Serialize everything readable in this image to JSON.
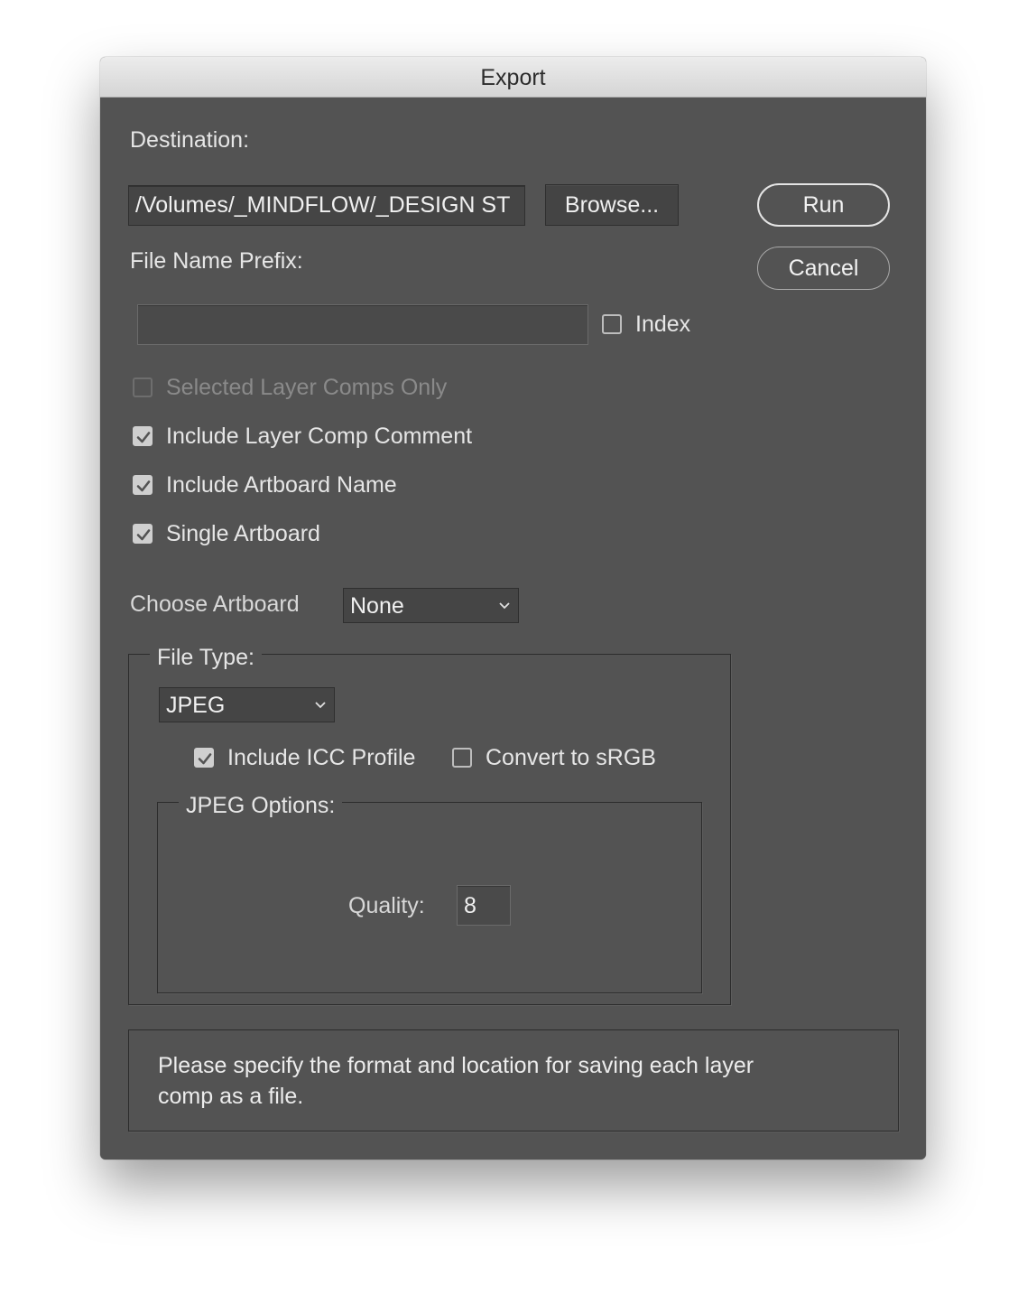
{
  "window": {
    "title": "Export"
  },
  "destination": {
    "label": "Destination:",
    "value": "/Volumes/_MINDFLOW/_DESIGN ST",
    "browse_label": "Browse..."
  },
  "actions": {
    "run_label": "Run",
    "cancel_label": "Cancel"
  },
  "prefix": {
    "label": "File Name Prefix:",
    "value": "",
    "index_label": "Index",
    "index_checked": false
  },
  "options": [
    {
      "label": "Selected Layer Comps Only",
      "checked": false,
      "disabled": true
    },
    {
      "label": "Include Layer Comp Comment",
      "checked": true,
      "disabled": false
    },
    {
      "label": "Include Artboard Name",
      "checked": true,
      "disabled": false
    },
    {
      "label": "Single Artboard",
      "checked": true,
      "disabled": false
    }
  ],
  "artboard": {
    "label": "Choose Artboard",
    "selected": "None"
  },
  "file_type": {
    "legend": "File Type:",
    "selected": "JPEG",
    "icc_label": "Include ICC Profile",
    "icc_checked": true,
    "srgb_label": "Convert to sRGB",
    "srgb_checked": false
  },
  "jpeg_options": {
    "legend": "JPEG Options:",
    "quality_label": "Quality:",
    "quality_value": "8"
  },
  "info": {
    "line1": "Please specify the format and location for saving each layer",
    "line2": "comp as a file."
  },
  "icons": {
    "check": "checkmark-icon",
    "dropdown": "chevron-down-icon"
  }
}
